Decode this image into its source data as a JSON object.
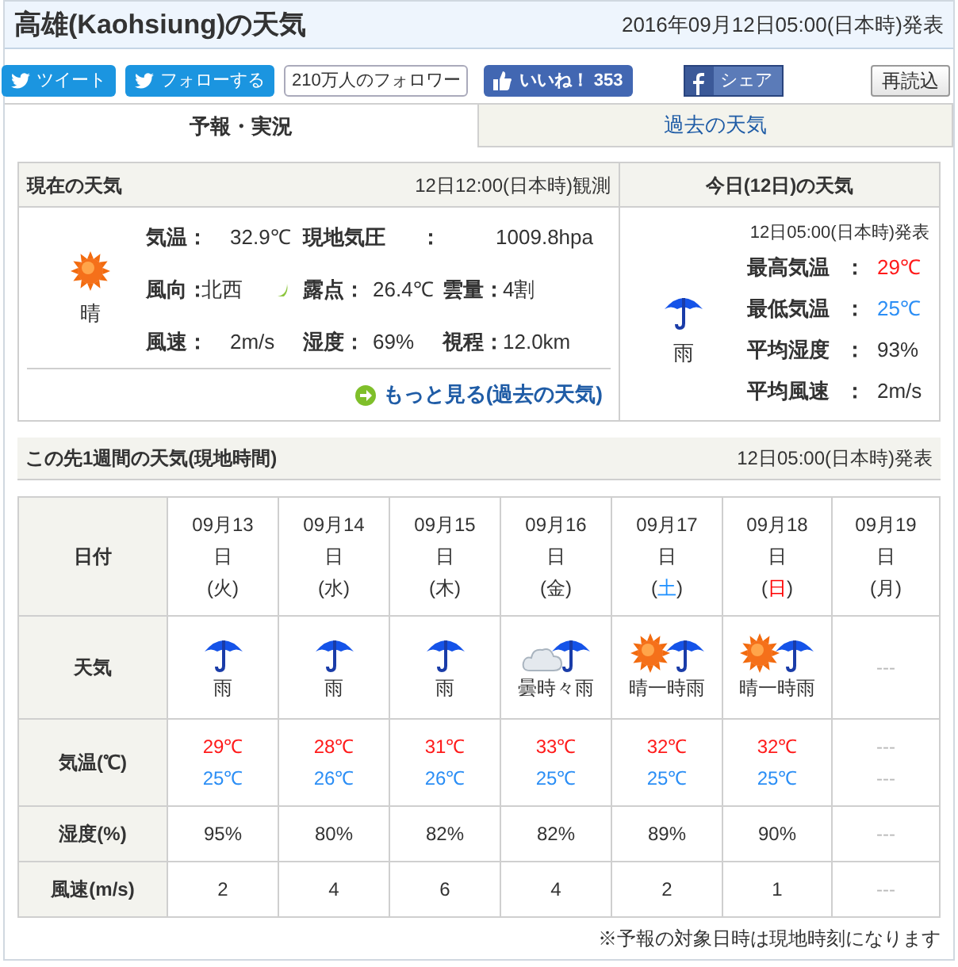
{
  "header": {
    "title": "高雄(Kaohsiung)の天気",
    "issued": "2016年09月12日05:00(日本時)発表"
  },
  "social": {
    "tweet": "ツイート",
    "follow": "フォローする",
    "followers": "210万人のフォロワー",
    "like": "いいね！",
    "like_count": "353",
    "share": "シェア",
    "reload": "再読込"
  },
  "tabs": [
    {
      "label": "予報・実況",
      "selected": true
    },
    {
      "label": "過去の天気",
      "selected": false
    }
  ],
  "current": {
    "title": "現在の天気",
    "observed": "12日12:00(日本時)観測",
    "weather": {
      "kind": "sunny",
      "label": "晴"
    },
    "rows": [
      [
        {
          "label": "気温：",
          "value": "32.9℃"
        },
        {
          "label": "現地気圧",
          "sep": "：",
          "value": "1009.8hpa"
        }
      ],
      [
        {
          "label": "風向：",
          "value": "北西",
          "kind": "wind"
        },
        {
          "label": "露点：",
          "value": "26.4℃"
        },
        {
          "label": "雲量：",
          "value": "4割"
        }
      ],
      [
        {
          "label": "風速：",
          "value": "2m/s"
        },
        {
          "label": "湿度：",
          "value": "69%"
        },
        {
          "label": "視程：",
          "value": "12.0km"
        }
      ]
    ],
    "link": "もっと見る(過去の天気)"
  },
  "today": {
    "title": "今日(12日)の天気",
    "issued": "12日05:00(日本時)発表",
    "weather": {
      "kind": "rain",
      "label": "雨"
    },
    "rows": [
      {
        "label": "最高気温",
        "sep": "：",
        "value": "29℃",
        "kind": "high"
      },
      {
        "label": "最低気温",
        "sep": "：",
        "value": "25℃",
        "kind": "low"
      },
      {
        "label": "平均湿度",
        "sep": "：",
        "value": "93%",
        "kind": "plain"
      },
      {
        "label": "平均風速",
        "sep": "：",
        "value": "2m/s",
        "kind": "plain"
      }
    ]
  },
  "week": {
    "title": "この先1週間の天気(現地時間)",
    "issued": "12日05:00(日本時)発表",
    "row_labels": {
      "date": "日付",
      "weather": "天気",
      "temp": "気温(℃)",
      "humidity": "湿度(%)",
      "wind": "風速(m/s)"
    },
    "weekday_brackets": [
      "(",
      ")"
    ],
    "days": [
      {
        "date": "09月13",
        "unit": "日",
        "weekday": "火",
        "color": "#333333",
        "weather": {
          "kind": "rain",
          "label": "雨"
        },
        "high": "29℃",
        "low": "25℃",
        "humidity": "95%",
        "wind": "2"
      },
      {
        "date": "09月14",
        "unit": "日",
        "weekday": "水",
        "color": "#333333",
        "weather": {
          "kind": "rain",
          "label": "雨"
        },
        "high": "28℃",
        "low": "26℃",
        "humidity": "80%",
        "wind": "4"
      },
      {
        "date": "09月15",
        "unit": "日",
        "weekday": "木",
        "color": "#333333",
        "weather": {
          "kind": "rain",
          "label": "雨"
        },
        "high": "31℃",
        "low": "26℃",
        "humidity": "82%",
        "wind": "6"
      },
      {
        "date": "09月16",
        "unit": "日",
        "weekday": "金",
        "color": "#333333",
        "weather": {
          "kind": "cloudy_rain",
          "label": "曇時々雨"
        },
        "high": "33℃",
        "low": "25℃",
        "humidity": "82%",
        "wind": "4"
      },
      {
        "date": "09月17",
        "unit": "日",
        "weekday": "土",
        "color": "#1e90ff",
        "weather": {
          "kind": "sunny_rain",
          "label": "晴一時雨"
        },
        "high": "32℃",
        "low": "25℃",
        "humidity": "89%",
        "wind": "2"
      },
      {
        "date": "09月18",
        "unit": "日",
        "weekday": "日",
        "color": "#ff0000",
        "weather": {
          "kind": "sunny_rain",
          "label": "晴一時雨"
        },
        "high": "32℃",
        "low": "25℃",
        "humidity": "90%",
        "wind": "1"
      },
      {
        "date": "09月19",
        "unit": "日",
        "weekday": "月",
        "color": "#333333",
        "weather": {
          "kind": "none",
          "label": "---"
        },
        "high": "---",
        "low": "---",
        "humidity": "---",
        "wind": "---"
      }
    ]
  },
  "footnote": "※予報の対象日時は現地時刻になります"
}
